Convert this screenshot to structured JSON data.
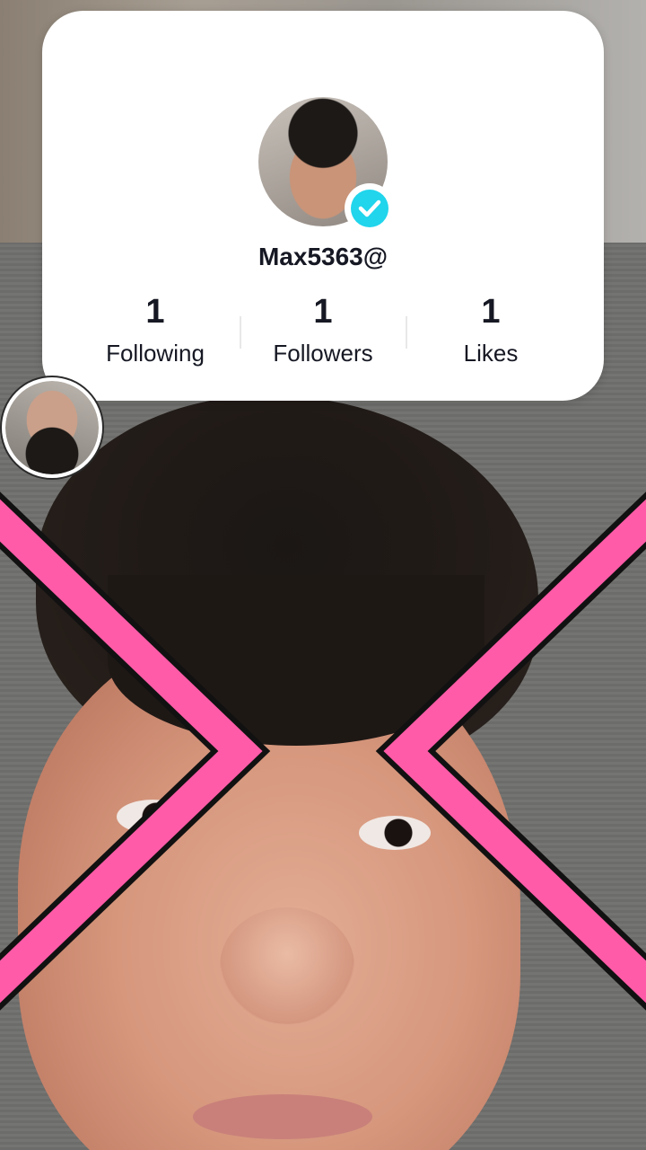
{
  "profile": {
    "username": "Max5363@",
    "verified_icon": "verified-check-icon",
    "stats": [
      {
        "value": "1",
        "label": "Following"
      },
      {
        "value": "1",
        "label": "Followers"
      },
      {
        "value": "1",
        "label": "Likes"
      }
    ]
  },
  "colors": {
    "badge": "#20d5ec",
    "chevron": "#ff5ba8",
    "card": "#ffffff"
  }
}
